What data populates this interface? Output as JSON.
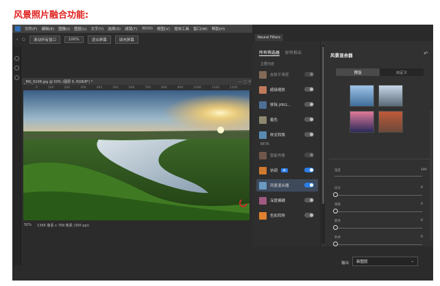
{
  "caption": "风景照片融合功能:",
  "menu": [
    "文件(F)",
    "编辑(E)",
    "图像(I)",
    "图层(L)",
    "文字(Y)",
    "选择(S)",
    "滤镜(T)",
    "3D(D)",
    "视图(V)",
    "增效工具",
    "窗口(W)",
    "帮助(H)"
  ],
  "options": {
    "all_windows": "滚动所有窗口",
    "zoom": "100%",
    "fit": "适合屏幕",
    "fill": "填充屏幕"
  },
  "document": {
    "tab_title": "_MG_6108.jpg @ 50% (图层 0, RGB/8*) *",
    "ruler": [
      "0",
      "100",
      "200",
      "300",
      "400",
      "500",
      "600",
      "700",
      "800",
      "900",
      "1000",
      "1100",
      "1200"
    ],
    "zoom_status": "50%",
    "size_status": "1366 像素 x 768 像素 (300 ppi)"
  },
  "neural": {
    "window_tab": "Neural Filters",
    "tabs": {
      "all": "所有筛选器",
      "wait": "即将推出"
    },
    "sections": {
      "featured": "主要内容",
      "beta": "BETA"
    },
    "filters": [
      {
        "label": "皮肤平滑度",
        "thumb": "#c99a7c",
        "on": false,
        "dim": true
      },
      {
        "label": "超级缩放",
        "thumb": "#c07a5a",
        "on": false
      },
      {
        "label": "移除 JPEG...",
        "thumb": "#4e6f95",
        "on": false
      },
      {
        "label": "着色",
        "thumb": "#8e8a70",
        "on": false
      },
      {
        "label": "样式转换",
        "thumb": "#5a8ab0",
        "on": false
      }
    ],
    "beta_filters": [
      {
        "label": "智能肖像",
        "thumb": "#a87a66",
        "on": false,
        "dim": true
      },
      {
        "label": "协调",
        "thumb": "#d07a30",
        "on": true,
        "badge": "新"
      },
      {
        "label": "风景混合器",
        "thumb": "#6a9ac0",
        "on": true,
        "selected": true
      },
      {
        "label": "深度模糊",
        "thumb": "#a05a80",
        "on": false
      },
      {
        "label": "色彩转移",
        "thumb": "#e08030",
        "on": false
      }
    ],
    "detail": {
      "title": "风景混合器",
      "undo_icon": "↶",
      "segments": [
        "预设",
        "自定义"
      ],
      "presets": [
        {
          "colors": [
            "#9fc4e8",
            "#3f6e9a"
          ]
        },
        {
          "colors": [
            "#c8d8e8",
            "#5a6a78"
          ]
        },
        {
          "colors": [
            "#e07a9a",
            "#2a2a5a"
          ]
        },
        {
          "colors": [
            "#c05a3a",
            "#6a4a3a"
          ]
        }
      ],
      "strength": {
        "label": "强度",
        "value": "100"
      },
      "sliders": [
        {
          "label": "白天",
          "value": "0"
        },
        {
          "label": "夜晚",
          "value": "0"
        },
        {
          "label": "夏季",
          "value": "0"
        },
        {
          "label": "秋季",
          "value": "0"
        },
        {
          "label": "冬季",
          "value": "0"
        }
      ]
    },
    "output_label": "输出",
    "output_value": "新图层"
  }
}
